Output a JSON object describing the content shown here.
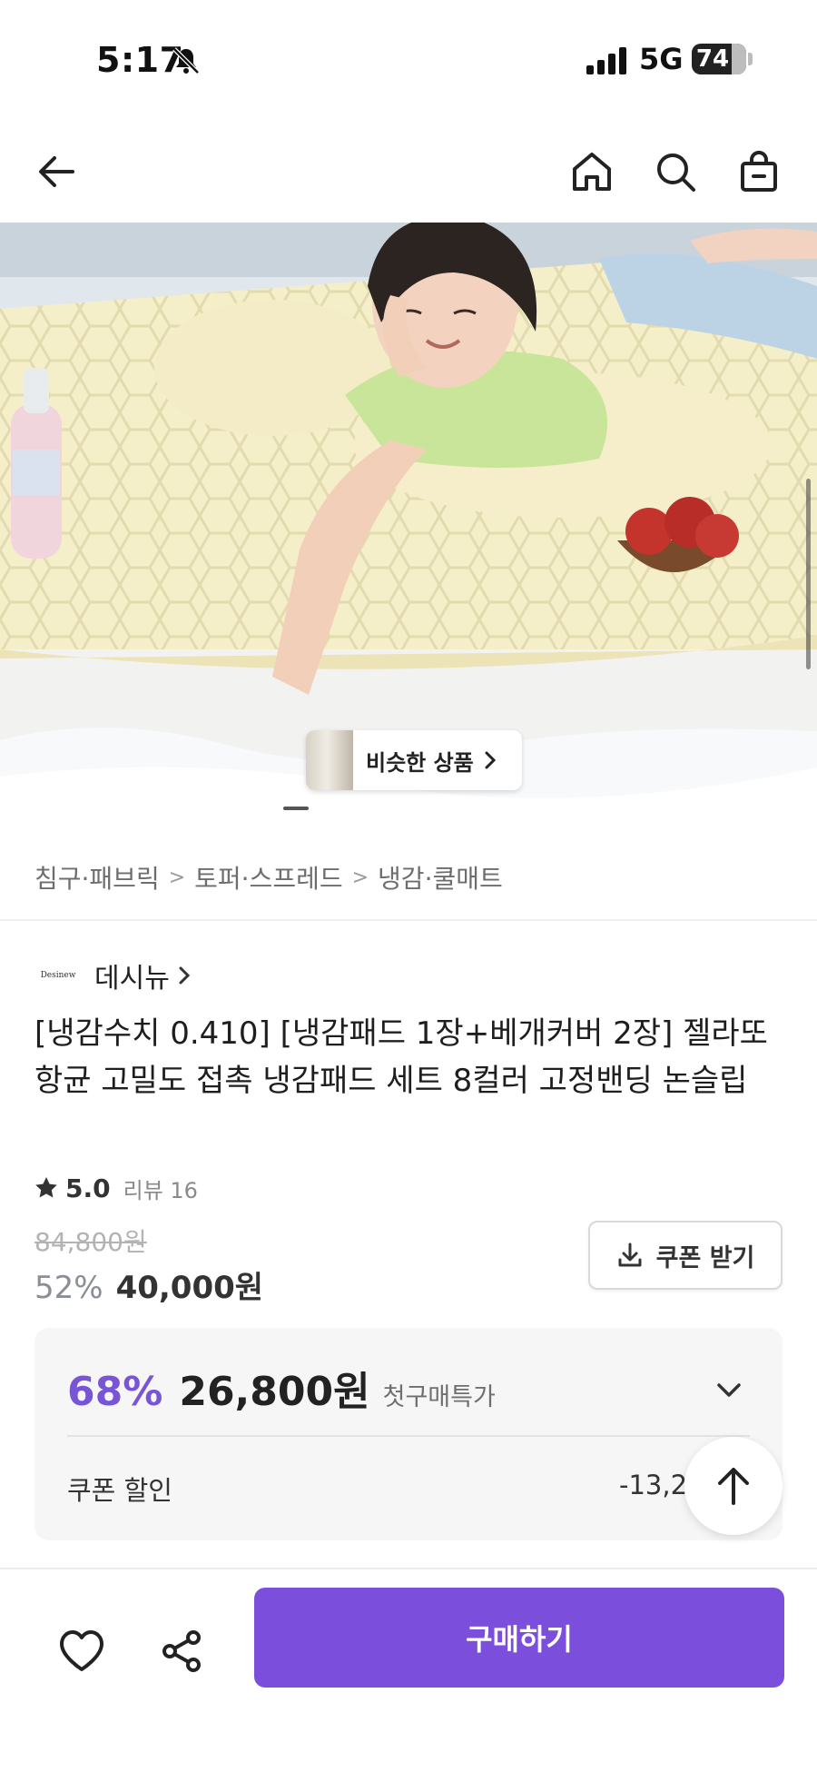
{
  "status_bar": {
    "time": "5:17",
    "network": "5G",
    "battery_level": 74,
    "battery_label": "74"
  },
  "nav": {
    "back_icon": "arrow-left-icon",
    "home_icon": "home-icon",
    "search_icon": "search-icon",
    "cart_icon": "shopping-bag-icon"
  },
  "hero": {
    "similar_label": "비슷한 상품",
    "gallery_progress": 0.1
  },
  "breadcrumb": [
    "침구·패브릭",
    "토퍼·스프레드",
    "냉감·쿨매트"
  ],
  "brand": {
    "logo_text": "Desinew",
    "name": "데시뉴"
  },
  "product": {
    "title": "[냉감수치 0.410] [냉감패드 1장+베개커버 2장] 젤라또 항균 고밀도 접촉 냉감패드 세트 8컬러 고정밴딩 논슬립",
    "rating": "5.0",
    "review_count": "리뷰 16",
    "original_price": "84,800원",
    "discount_rate": "52%",
    "discount_price": "40,000원",
    "coupon_button": "쿠폰 받기"
  },
  "price_box": {
    "rate": "68%",
    "price": "26,800원",
    "badge": "첫구매특가",
    "coupon_label": "쿠폰 할인",
    "coupon_value": "-13,2"
  },
  "bottom_bar": {
    "buy_label": "구매하기"
  },
  "colors": {
    "accent": "#7b4fdb",
    "accent_text": "#7755d6"
  }
}
